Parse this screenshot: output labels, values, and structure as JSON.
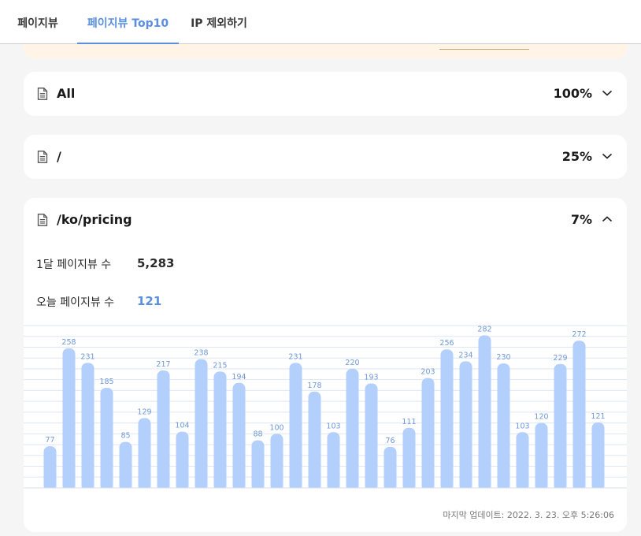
{
  "tabs": [
    {
      "label": "페이지뷰",
      "active": false
    },
    {
      "label": "페이지뷰 Top10",
      "active": true
    },
    {
      "label": "IP 제외하기",
      "active": false
    }
  ],
  "pages": [
    {
      "path": "All",
      "percent": "100%",
      "expanded": false
    },
    {
      "path": "/",
      "percent": "25%",
      "expanded": false
    },
    {
      "path": "/ko/pricing",
      "percent": "7%",
      "expanded": true
    }
  ],
  "detail": {
    "monthly_label": "1달 페이지뷰 수",
    "monthly_value": "5,283",
    "today_label": "오늘 페이지뷰 수",
    "today_value": "121",
    "last_updated": "마지막 업데이트: 2022. 3. 23. 오후 5:26:06"
  },
  "icons": {
    "page": "document-icon",
    "collapsed": "chevron-down-icon",
    "expanded": "chevron-up-icon"
  },
  "colors": {
    "accent": "#5a8fe0",
    "bar": "#b3cffb",
    "bar_label": "#6e98d8",
    "banner": "#fff4e6"
  },
  "chart_data": {
    "type": "bar",
    "values": [
      77,
      258,
      231,
      185,
      85,
      129,
      217,
      104,
      238,
      215,
      194,
      88,
      100,
      231,
      178,
      103,
      220,
      193,
      76,
      111,
      203,
      256,
      234,
      282,
      230,
      103,
      120,
      229,
      272,
      121
    ],
    "ylim": [
      0,
      300
    ],
    "grid": true,
    "legend": "none"
  }
}
